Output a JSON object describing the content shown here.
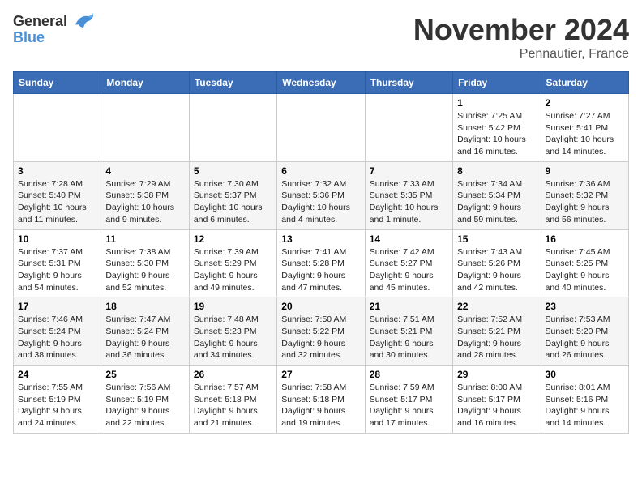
{
  "header": {
    "logo_line1": "General",
    "logo_line2": "Blue",
    "month": "November 2024",
    "location": "Pennautier, France"
  },
  "weekdays": [
    "Sunday",
    "Monday",
    "Tuesday",
    "Wednesday",
    "Thursday",
    "Friday",
    "Saturday"
  ],
  "weeks": [
    [
      {
        "day": "",
        "info": ""
      },
      {
        "day": "",
        "info": ""
      },
      {
        "day": "",
        "info": ""
      },
      {
        "day": "",
        "info": ""
      },
      {
        "day": "",
        "info": ""
      },
      {
        "day": "1",
        "info": "Sunrise: 7:25 AM\nSunset: 5:42 PM\nDaylight: 10 hours and 16 minutes."
      },
      {
        "day": "2",
        "info": "Sunrise: 7:27 AM\nSunset: 5:41 PM\nDaylight: 10 hours and 14 minutes."
      }
    ],
    [
      {
        "day": "3",
        "info": "Sunrise: 7:28 AM\nSunset: 5:40 PM\nDaylight: 10 hours and 11 minutes."
      },
      {
        "day": "4",
        "info": "Sunrise: 7:29 AM\nSunset: 5:38 PM\nDaylight: 10 hours and 9 minutes."
      },
      {
        "day": "5",
        "info": "Sunrise: 7:30 AM\nSunset: 5:37 PM\nDaylight: 10 hours and 6 minutes."
      },
      {
        "day": "6",
        "info": "Sunrise: 7:32 AM\nSunset: 5:36 PM\nDaylight: 10 hours and 4 minutes."
      },
      {
        "day": "7",
        "info": "Sunrise: 7:33 AM\nSunset: 5:35 PM\nDaylight: 10 hours and 1 minute."
      },
      {
        "day": "8",
        "info": "Sunrise: 7:34 AM\nSunset: 5:34 PM\nDaylight: 9 hours and 59 minutes."
      },
      {
        "day": "9",
        "info": "Sunrise: 7:36 AM\nSunset: 5:32 PM\nDaylight: 9 hours and 56 minutes."
      }
    ],
    [
      {
        "day": "10",
        "info": "Sunrise: 7:37 AM\nSunset: 5:31 PM\nDaylight: 9 hours and 54 minutes."
      },
      {
        "day": "11",
        "info": "Sunrise: 7:38 AM\nSunset: 5:30 PM\nDaylight: 9 hours and 52 minutes."
      },
      {
        "day": "12",
        "info": "Sunrise: 7:39 AM\nSunset: 5:29 PM\nDaylight: 9 hours and 49 minutes."
      },
      {
        "day": "13",
        "info": "Sunrise: 7:41 AM\nSunset: 5:28 PM\nDaylight: 9 hours and 47 minutes."
      },
      {
        "day": "14",
        "info": "Sunrise: 7:42 AM\nSunset: 5:27 PM\nDaylight: 9 hours and 45 minutes."
      },
      {
        "day": "15",
        "info": "Sunrise: 7:43 AM\nSunset: 5:26 PM\nDaylight: 9 hours and 42 minutes."
      },
      {
        "day": "16",
        "info": "Sunrise: 7:45 AM\nSunset: 5:25 PM\nDaylight: 9 hours and 40 minutes."
      }
    ],
    [
      {
        "day": "17",
        "info": "Sunrise: 7:46 AM\nSunset: 5:24 PM\nDaylight: 9 hours and 38 minutes."
      },
      {
        "day": "18",
        "info": "Sunrise: 7:47 AM\nSunset: 5:24 PM\nDaylight: 9 hours and 36 minutes."
      },
      {
        "day": "19",
        "info": "Sunrise: 7:48 AM\nSunset: 5:23 PM\nDaylight: 9 hours and 34 minutes."
      },
      {
        "day": "20",
        "info": "Sunrise: 7:50 AM\nSunset: 5:22 PM\nDaylight: 9 hours and 32 minutes."
      },
      {
        "day": "21",
        "info": "Sunrise: 7:51 AM\nSunset: 5:21 PM\nDaylight: 9 hours and 30 minutes."
      },
      {
        "day": "22",
        "info": "Sunrise: 7:52 AM\nSunset: 5:21 PM\nDaylight: 9 hours and 28 minutes."
      },
      {
        "day": "23",
        "info": "Sunrise: 7:53 AM\nSunset: 5:20 PM\nDaylight: 9 hours and 26 minutes."
      }
    ],
    [
      {
        "day": "24",
        "info": "Sunrise: 7:55 AM\nSunset: 5:19 PM\nDaylight: 9 hours and 24 minutes."
      },
      {
        "day": "25",
        "info": "Sunrise: 7:56 AM\nSunset: 5:19 PM\nDaylight: 9 hours and 22 minutes."
      },
      {
        "day": "26",
        "info": "Sunrise: 7:57 AM\nSunset: 5:18 PM\nDaylight: 9 hours and 21 minutes."
      },
      {
        "day": "27",
        "info": "Sunrise: 7:58 AM\nSunset: 5:18 PM\nDaylight: 9 hours and 19 minutes."
      },
      {
        "day": "28",
        "info": "Sunrise: 7:59 AM\nSunset: 5:17 PM\nDaylight: 9 hours and 17 minutes."
      },
      {
        "day": "29",
        "info": "Sunrise: 8:00 AM\nSunset: 5:17 PM\nDaylight: 9 hours and 16 minutes."
      },
      {
        "day": "30",
        "info": "Sunrise: 8:01 AM\nSunset: 5:16 PM\nDaylight: 9 hours and 14 minutes."
      }
    ]
  ]
}
